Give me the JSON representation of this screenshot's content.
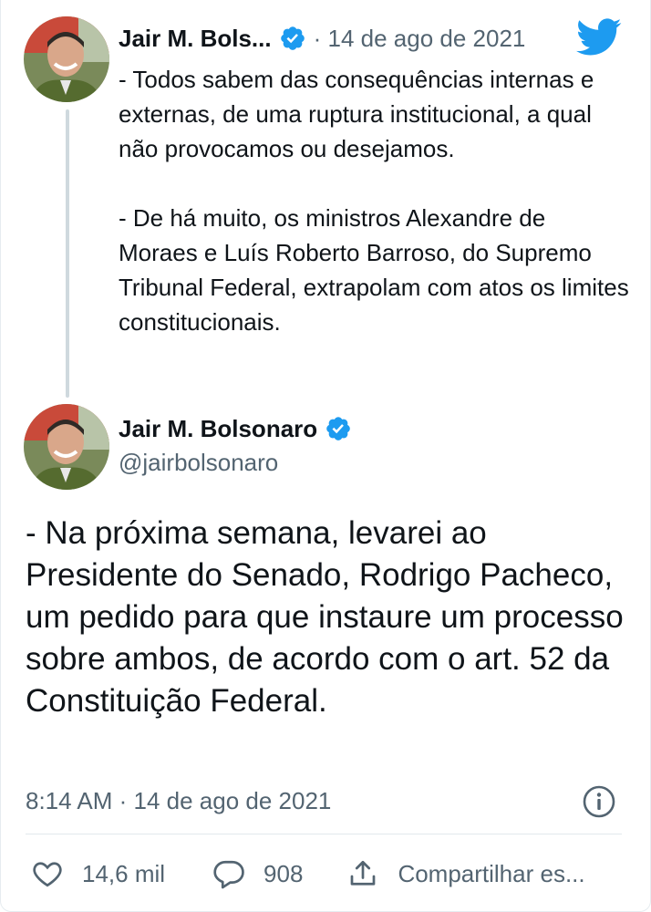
{
  "colors": {
    "brand": "#1d9bf0",
    "text_primary": "#0f1419",
    "text_secondary": "#536471",
    "thread_line": "#cfd9de"
  },
  "parent_tweet": {
    "author_name": "Jair M. Bols...",
    "separator_date": "· 14 de ago de 2021",
    "paragraph_1": "- Todos sabem das consequências internas e externas, de uma ruptura institucional, a qual não provocamos ou desejamos.",
    "paragraph_2": "- De há muito, os ministros Alexandre de Moraes e Luís Roberto Barroso, do Supremo Tribunal Federal, extrapolam com atos os limites constitucionais.",
    "icons": [
      "avatar",
      "verified-icon",
      "twitter-bird-icon"
    ]
  },
  "main_tweet": {
    "author_name": "Jair M. Bolsonaro",
    "handle": "@jairbolsonaro",
    "text": "- Na próxima semana, levarei ao Presidente do Senado, Rodrigo Pacheco, um pedido para que instaure um processo sobre ambos, de acordo com o art. 52 da Constituição Federal.",
    "timestamp": "8:14 AM · 14 de ago de 2021",
    "icons": [
      "avatar",
      "verified-icon",
      "info-icon"
    ]
  },
  "actions": {
    "likes_count": "14,6 mil",
    "replies_count": "908",
    "share_label": "Compartilhar es...",
    "icons": [
      "heart-icon",
      "reply-bubble-icon",
      "share-icon"
    ]
  }
}
